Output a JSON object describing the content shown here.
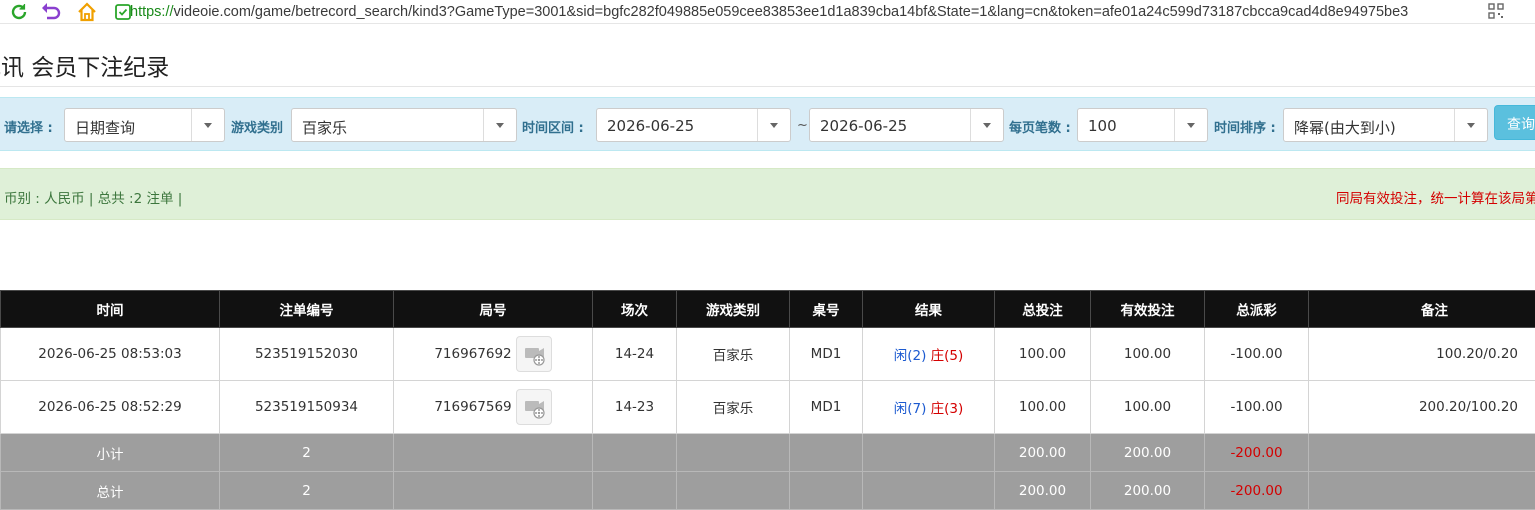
{
  "browser": {
    "url_proto": "https://",
    "url_rest": "videoie.com/game/betrecord_search/kind3?GameType=3001&sid=bgfc282f049885e059cee83853ee1d1a839cba14bf&State=1&lang=cn&token=afe01a24c599d73187cbcca9cad4d8e94975be3"
  },
  "page": {
    "title": "视讯 会员下注纪录"
  },
  "filters": {
    "select_label": "请选择 :",
    "select_value": "日期查询",
    "game_type_label": "游戏类别",
    "game_type_value": "百家乐",
    "time_range_label": "时间区间 :",
    "date_from": "2026-06-25",
    "tilde": "~",
    "date_to": "2026-06-25",
    "per_page_label": "每页笔数 :",
    "per_page_value": "100",
    "sort_label": "时间排序 :",
    "sort_value": "降幂(由大到小)",
    "query_button": "查询"
  },
  "info": {
    "summary": "币别 : 人民币 | 总共 :2 注单 |",
    "notice": "同局有效投注，统一计算在该局第一笔注单"
  },
  "table": {
    "headers": [
      "时间",
      "注单编号",
      "局号",
      "场次",
      "游戏类别",
      "桌号",
      "结果",
      "总投注",
      "有效投注",
      "总派彩",
      "备注"
    ],
    "rows": [
      {
        "time": "2026-06-25 08:53:03",
        "order_no": "523519152030",
        "round_no": "716967692",
        "session": "14-24",
        "game": "百家乐",
        "table": "MD1",
        "result_player": "闲(2)",
        "result_banker": "庄(5)",
        "total_bet": "100.00",
        "valid_bet": "100.00",
        "payout": "-100.00",
        "remark": "100.20/0.20"
      },
      {
        "time": "2026-06-25 08:52:29",
        "order_no": "523519150934",
        "round_no": "716967569",
        "session": "14-23",
        "game": "百家乐",
        "table": "MD1",
        "result_player": "闲(7)",
        "result_banker": "庄(3)",
        "total_bet": "100.00",
        "valid_bet": "100.00",
        "payout": "-100.00",
        "remark": "200.20/100.20"
      }
    ],
    "subtotal": {
      "label": "小计",
      "count": "2",
      "total_bet": "200.00",
      "valid_bet": "200.00",
      "payout": "-200.00"
    },
    "total": {
      "label": "总计",
      "count": "2",
      "total_bet": "200.00",
      "valid_bet": "200.00",
      "payout": "-200.00"
    }
  },
  "colors": {
    "header_bg": "#111111",
    "summary_bg": "#9e9e9e",
    "filter_bg": "#d9edf7",
    "info_bg": "#dff0d8",
    "negative": "#d40000",
    "bet_blue": "#1c5ad0"
  },
  "icons": [
    "refresh-icon",
    "undo-icon",
    "home-icon",
    "shield-icon",
    "qr-code-icon",
    "video-replay-icon"
  ]
}
